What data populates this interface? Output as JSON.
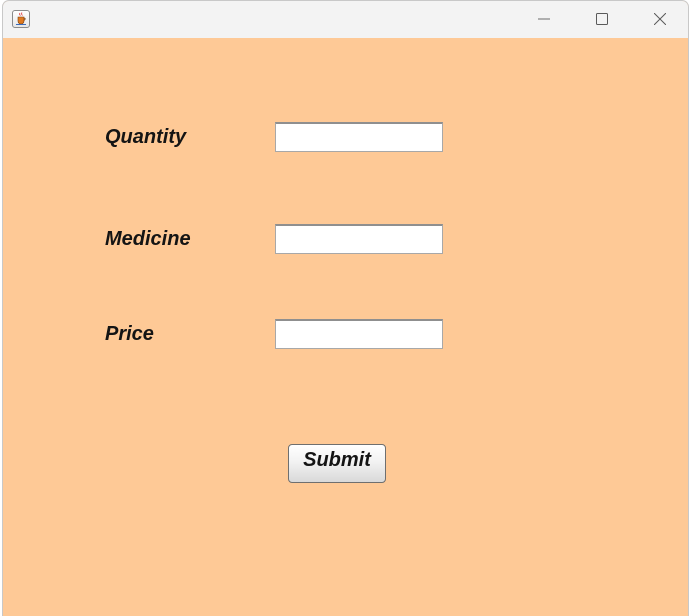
{
  "window": {
    "icon": "java-icon",
    "controls": [
      "minimize-icon",
      "maximize-icon",
      "close-icon"
    ],
    "background_color": "#fec996"
  },
  "form": {
    "fields": [
      {
        "label": "Quantity",
        "value": ""
      },
      {
        "label": "Medicine",
        "value": ""
      },
      {
        "label": "Price",
        "value": ""
      }
    ],
    "submit_label": "Submit"
  }
}
